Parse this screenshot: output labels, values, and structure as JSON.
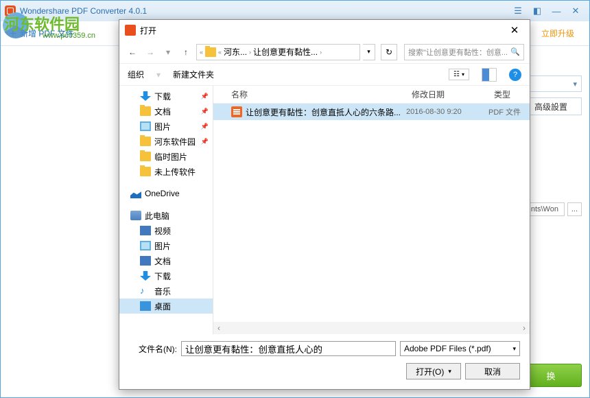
{
  "app": {
    "title": "Wondershare PDF Converter 4.0.1",
    "addPdf": "新增 PDF 文件",
    "upgrade": "立即升级",
    "advanced": "高级設置",
    "outputPath": "nts\\Won",
    "convert": "换"
  },
  "watermark": {
    "text": "河东软件园",
    "url": "www.pc0359.cn"
  },
  "dialog": {
    "title": "打开",
    "breadcrumb": {
      "p1": "河东...",
      "p2": "让创意更有黏性..."
    },
    "searchPlaceholder": "搜索\"让创意更有黏性：创意...",
    "organize": "组织",
    "newFolder": "新建文件夹",
    "viewMode": "☰",
    "tree": [
      {
        "icon": "icon-dl",
        "label": "下载",
        "pin": true,
        "l": 1
      },
      {
        "icon": "icon-folder",
        "label": "文档",
        "pin": true,
        "l": 1
      },
      {
        "icon": "icon-pic",
        "label": "图片",
        "pin": true,
        "l": 1
      },
      {
        "icon": "icon-folder",
        "label": "河东软件园",
        "pin": true,
        "l": 1
      },
      {
        "icon": "icon-folder",
        "label": "临时图片",
        "l": 1
      },
      {
        "icon": "icon-folder",
        "label": "未上传软件",
        "l": 1
      },
      {
        "spacer": true
      },
      {
        "icon": "icon-od",
        "label": "OneDrive",
        "l": 0
      },
      {
        "spacer": true
      },
      {
        "icon": "icon-drive",
        "label": "此电脑",
        "l": 0
      },
      {
        "icon": "icon-vid",
        "label": "视频",
        "l": 1
      },
      {
        "icon": "icon-pic",
        "label": "图片",
        "l": 1
      },
      {
        "icon": "icon-doc",
        "label": "文档",
        "l": 1
      },
      {
        "icon": "icon-dl",
        "label": "下载",
        "l": 1
      },
      {
        "icon": "icon-music",
        "label": "音乐",
        "l": 1,
        "glyph": "♪"
      },
      {
        "icon": "icon-desk",
        "label": "桌面",
        "l": 1,
        "sel": true
      }
    ],
    "columns": {
      "name": "名称",
      "date": "修改日期",
      "type": "类型"
    },
    "files": [
      {
        "name": "让创意更有黏性：创意直抵人心的六条路...",
        "date": "2016-08-30 9:20",
        "type": "PDF 文件",
        "sel": true
      }
    ],
    "fileNameLabel": "文件名(N):",
    "fileNameValue": "让创意更有黏性：创意直抵人心的",
    "fileType": "Adobe PDF Files (*.pdf)",
    "openBtn": "打开(O)",
    "cancelBtn": "取消"
  }
}
